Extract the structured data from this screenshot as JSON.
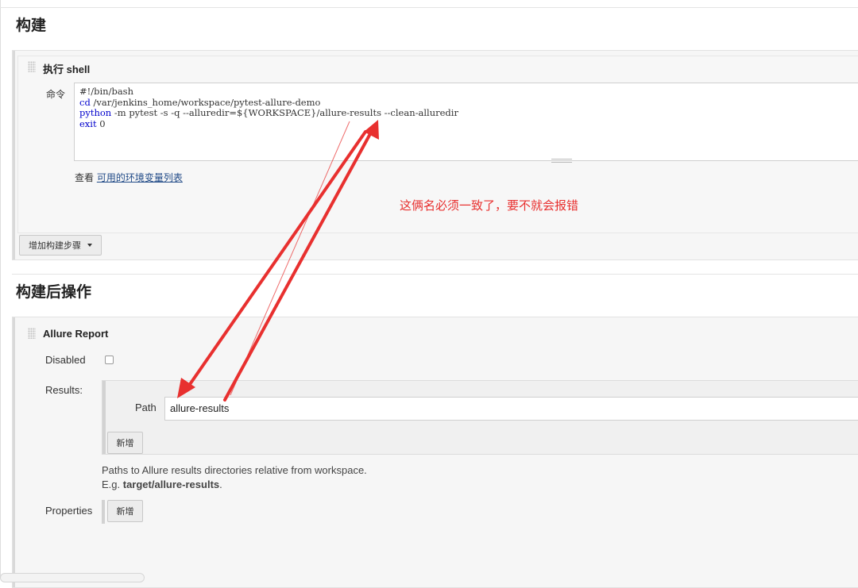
{
  "build": {
    "title": "构建",
    "step": {
      "header": "执行 shell",
      "command_label": "命令",
      "command_lines": {
        "l1": "#!/bin/bash",
        "l2_kw": "cd",
        "l2_rest": " /var/jenkins_home/workspace/pytest-allure-demo",
        "l3_kw": "python",
        "l3_rest": " -m pytest -s -q --alluredir=${WORKSPACE}/allure-results --clean-alluredir",
        "l4_kw": "exit",
        "l4_rest": " 0"
      },
      "env_prefix": "查看",
      "env_link": "可用的环境变量列表"
    },
    "add_step_button": "增加构建步骤"
  },
  "annotation": "这俩名必须一致了，要不就会报错",
  "post_build": {
    "title": "构建后操作",
    "allure": {
      "header": "Allure Report",
      "disabled_label": "Disabled",
      "disabled_checked": false,
      "results_label": "Results:",
      "path_label": "Path",
      "path_value": "allure-results",
      "add_button": "新增",
      "help_line1": "Paths to Allure results directories relative from workspace.",
      "help_line2_prefix": "E.g.",
      "help_line2_bold": "target/allure-results",
      "help_line2_suffix": ".",
      "properties_label": "Properties",
      "properties_add_button": "新增"
    }
  },
  "colors": {
    "annotation_red": "#e8302f",
    "link_blue": "#204a87",
    "code_keyword": "#0000cc"
  }
}
